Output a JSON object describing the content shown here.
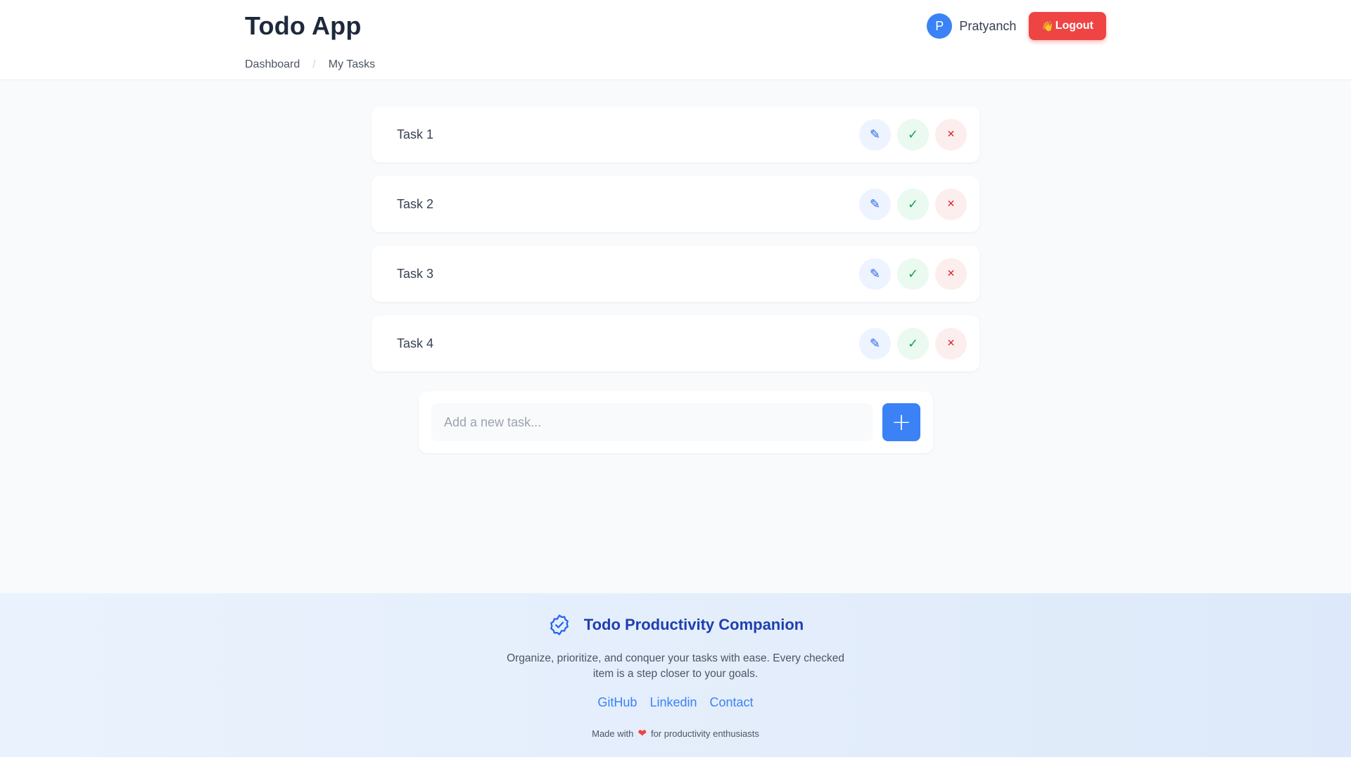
{
  "header": {
    "title": "Todo App",
    "breadcrumb": [
      "Dashboard",
      "My Tasks"
    ],
    "breadcrumb_separator": "/",
    "user": {
      "initial": "P",
      "name": "Pratyanch"
    },
    "logout_label": "Logout",
    "logout_icon": "👋"
  },
  "tasks": [
    {
      "label": "Task 1"
    },
    {
      "label": "Task 2"
    },
    {
      "label": "Task 3"
    },
    {
      "label": "Task 4"
    }
  ],
  "task_actions": {
    "edit_icon": "✎",
    "done_icon": "✓",
    "delete_icon": "✕"
  },
  "add_task": {
    "placeholder": "Add a new task...",
    "button_icon": "+"
  },
  "footer": {
    "title": "Todo Productivity Companion",
    "description": "Organize, prioritize, and conquer your tasks with ease. Every checked item is a step closer to your goals.",
    "links": [
      "GitHub",
      "Linkedin",
      "Contact"
    ],
    "made_with_prefix": "Made with",
    "made_with_suffix": "for productivity enthusiasts",
    "heart_icon": "❤"
  },
  "colors": {
    "primary": "#3b82f6",
    "danger": "#ef4444",
    "success": "#16a34a",
    "footer_title": "#1e40af"
  }
}
